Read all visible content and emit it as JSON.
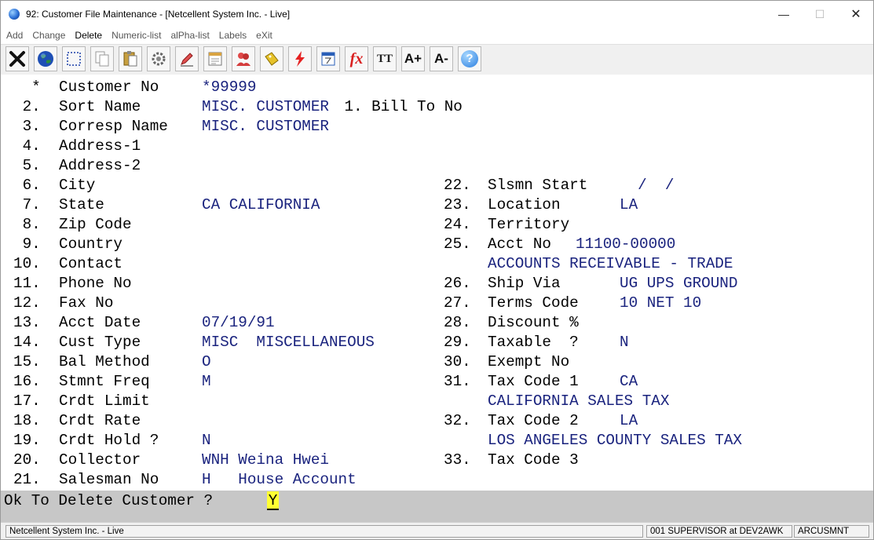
{
  "window": {
    "title": "92: Customer File Maintenance - [Netcellent System Inc. - Live]",
    "controls": {
      "minimize": "—",
      "maximize": "☐",
      "close": "✕"
    }
  },
  "menu": [
    "Add",
    "Change",
    "Delete",
    "Numeric-list",
    "alPha-list",
    "Labels",
    "eXit"
  ],
  "toolbar": {
    "icons": [
      "exit-icon",
      "globe-icon",
      "select-icon",
      "copy-icon",
      "paste-icon",
      "settings-icon",
      "edit-icon",
      "notes-icon",
      "users-icon",
      "label-icon",
      "lightning-icon",
      "calculator-icon",
      "function-icon",
      "font-size-icon",
      "font-increase-icon",
      "font-decrease-icon",
      "help-icon"
    ],
    "function_label": "fx",
    "font_label": "TT",
    "font_plus_label": "A+",
    "font_minus_label": "A-",
    "help_label": "?"
  },
  "form": {
    "left": [
      {
        "num": "  *",
        "label": "Customer No",
        "value": "*99999"
      },
      {
        "num": " 2.",
        "label": "Sort Name",
        "value": "MISC. CUSTOMER"
      },
      {
        "num": " 3.",
        "label": "Corresp Name",
        "value": "MISC. CUSTOMER"
      },
      {
        "num": " 4.",
        "label": "Address-1",
        "value": ""
      },
      {
        "num": " 5.",
        "label": "Address-2",
        "value": ""
      },
      {
        "num": " 6.",
        "label": "City",
        "value": ""
      },
      {
        "num": " 7.",
        "label": "State",
        "value": "CA CALIFORNIA"
      },
      {
        "num": " 8.",
        "label": "Zip Code",
        "value": ""
      },
      {
        "num": " 9.",
        "label": "Country",
        "value": ""
      },
      {
        "num": "10.",
        "label": "Contact",
        "value": ""
      },
      {
        "num": "11.",
        "label": "Phone No",
        "value": ""
      },
      {
        "num": "12.",
        "label": "Fax No",
        "value": ""
      },
      {
        "num": "13.",
        "label": "Acct Date",
        "value": "07/19/91"
      },
      {
        "num": "14.",
        "label": "Cust Type",
        "value": "MISC  MISCELLANEOUS"
      },
      {
        "num": "15.",
        "label": "Bal Method",
        "value": "O"
      },
      {
        "num": "16.",
        "label": "Stmnt Freq",
        "value": "M"
      },
      {
        "num": "17.",
        "label": "Crdt Limit",
        "value": ""
      },
      {
        "num": "18.",
        "label": "Crdt Rate",
        "value": ""
      },
      {
        "num": "19.",
        "label": "Crdt Hold ?",
        "value": "N"
      },
      {
        "num": "20.",
        "label": "Collector",
        "value": "WNH Weina Hwei"
      },
      {
        "num": "21.",
        "label": "Salesman No",
        "value": "H   House Account"
      }
    ],
    "bill_to": {
      "label": "1. Bill To No",
      "value": ""
    },
    "right": [
      {
        "row": 5,
        "num": "22.",
        "label": "Slsmn Start",
        "value": "  /  /"
      },
      {
        "row": 6,
        "num": "23.",
        "label": "Location",
        "value": "LA"
      },
      {
        "row": 7,
        "num": "24.",
        "label": "Territory",
        "value": ""
      },
      {
        "row": 8,
        "num": "25.",
        "label": "Acct No",
        "value": "11100-00000"
      },
      {
        "row": 9,
        "num": "",
        "label": "",
        "value": "ACCOUNTS RECEIVABLE - TRADE"
      },
      {
        "row": 10,
        "num": "26.",
        "label": "Ship Via",
        "value": "UG UPS GROUND"
      },
      {
        "row": 11,
        "num": "27.",
        "label": "Terms Code",
        "value": "10 NET 10"
      },
      {
        "row": 12,
        "num": "28.",
        "label": "Discount %",
        "value": ""
      },
      {
        "row": 13,
        "num": "29.",
        "label": "Taxable  ?",
        "value": "N"
      },
      {
        "row": 14,
        "num": "30.",
        "label": "Exempt No",
        "value": ""
      },
      {
        "row": 15,
        "num": "31.",
        "label": "Tax Code 1",
        "value": "CA"
      },
      {
        "row": 16,
        "num": "",
        "label": "",
        "value": "CALIFORNIA SALES TAX"
      },
      {
        "row": 17,
        "num": "32.",
        "label": "Tax Code 2",
        "value": "LA"
      },
      {
        "row": 18,
        "num": "",
        "label": "",
        "value": "LOS ANGELES COUNTY SALES TAX"
      },
      {
        "row": 19,
        "num": "33.",
        "label": "Tax Code 3",
        "value": ""
      }
    ]
  },
  "prompt": {
    "text": "Ok To Delete Customer ?",
    "input_value": "Y"
  },
  "status": {
    "company": "Netcellent System Inc. - Live",
    "user": "001 SUPERVISOR at DEV2AWK",
    "program": "ARCUSMNT"
  },
  "colors": {
    "value_text": "#1a237e",
    "prompt_bar": "#c7c7c7",
    "input_highlight": "#ffff33"
  }
}
